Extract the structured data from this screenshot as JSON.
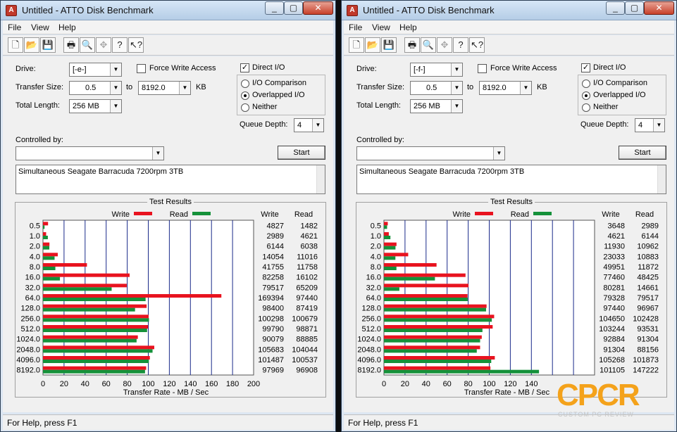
{
  "status_text": "For Help, press F1",
  "watermark": {
    "mark": "CPCR",
    "sub": "CUSTOM PC REVIEW"
  },
  "windows": [
    {
      "title": "Untitled - ATTO Disk Benchmark",
      "menu": [
        "File",
        "View",
        "Help"
      ],
      "controls": {
        "drive_label": "Drive:",
        "drive_value": "[-e-]",
        "transfer_label": "Transfer Size:",
        "transfer_from": "0.5",
        "to_label": "to",
        "transfer_to": "8192.0",
        "kb_label": "KB",
        "length_label": "Total Length:",
        "length_value": "256 MB",
        "force_write": "Force Write Access",
        "direct_io": "Direct I/O",
        "io_comparison": "I/O Comparison",
        "overlapped_io": "Overlapped I/O",
        "neither": "Neither",
        "queue_label": "Queue Depth:",
        "queue_value": "4",
        "controlled_label": "Controlled by:",
        "start_label": "Start",
        "description": "Simultaneous Seagate Barracuda 7200rpm 3TB"
      },
      "chart_data": {
        "type": "bar",
        "title": "Test Results",
        "xlabel": "Transfer Rate - MB / Sec",
        "xlim": [
          0,
          200
        ],
        "xticks": [
          "0",
          "20",
          "40",
          "60",
          "80",
          "100",
          "120",
          "140",
          "160",
          "180",
          "200"
        ],
        "categories": [
          "0.5",
          "1.0",
          "2.0",
          "4.0",
          "8.0",
          "16.0",
          "32.0",
          "64.0",
          "128.0",
          "256.0",
          "512.0",
          "1024.0",
          "2048.0",
          "4096.0",
          "8192.0"
        ],
        "legend": {
          "write": "Write",
          "read": "Read"
        },
        "col_headers": {
          "write": "Write",
          "read": "Read"
        },
        "write_color": "#e8131f",
        "read_color": "#15913a",
        "series": [
          {
            "name": "Write",
            "values": [
              4827,
              2989,
              6144,
              14054,
              41755,
              82258,
              79517,
              169394,
              98400,
              100298,
              99790,
              90079,
              105683,
              101487,
              97969
            ]
          },
          {
            "name": "Read",
            "values": [
              1482,
              4621,
              6038,
              11016,
              11758,
              16102,
              65209,
              97440,
              87419,
              100679,
              98871,
              88885,
              104044,
              100537,
              96908
            ]
          }
        ]
      }
    },
    {
      "title": "Untitled - ATTO Disk Benchmark",
      "menu": [
        "File",
        "View",
        "Help"
      ],
      "controls": {
        "drive_label": "Drive:",
        "drive_value": "[-f-]",
        "transfer_label": "Transfer Size:",
        "transfer_from": "0.5",
        "to_label": "to",
        "transfer_to": "8192.0",
        "kb_label": "KB",
        "length_label": "Total Length:",
        "length_value": "256 MB",
        "force_write": "Force Write Access",
        "direct_io": "Direct I/O",
        "io_comparison": "I/O Comparison",
        "overlapped_io": "Overlapped I/O",
        "neither": "Neither",
        "queue_label": "Queue Depth:",
        "queue_value": "4",
        "controlled_label": "Controlled by:",
        "start_label": "Start",
        "description": "Simultaneous Seagate Barracuda 7200rpm 3TB"
      },
      "chart_data": {
        "type": "bar",
        "title": "Test Results",
        "xlabel": "Transfer Rate - MB / Sec",
        "xlim": [
          0,
          200
        ],
        "xticks": [
          "0",
          "20",
          "40",
          "60",
          "80",
          "100",
          "120",
          "140"
        ],
        "categories": [
          "0.5",
          "1.0",
          "2.0",
          "4.0",
          "8.0",
          "16.0",
          "32.0",
          "64.0",
          "128.0",
          "256.0",
          "512.0",
          "1024.0",
          "2048.0",
          "4096.0",
          "8192.0"
        ],
        "legend": {
          "write": "Write",
          "read": "Read"
        },
        "col_headers": {
          "write": "Write",
          "read": "Read"
        },
        "write_color": "#e8131f",
        "read_color": "#15913a",
        "series": [
          {
            "name": "Write",
            "values": [
              3648,
              4621,
              11930,
              23033,
              49951,
              77460,
              80281,
              79328,
              97440,
              104650,
              103244,
              92884,
              91304,
              105268,
              101105
            ]
          },
          {
            "name": "Read",
            "values": [
              2989,
              6144,
              10962,
              10883,
              11872,
              48425,
              14661,
              79517,
              96967,
              102428,
              93531,
              91304,
              88156,
              101873,
              147222
            ]
          }
        ]
      }
    }
  ]
}
